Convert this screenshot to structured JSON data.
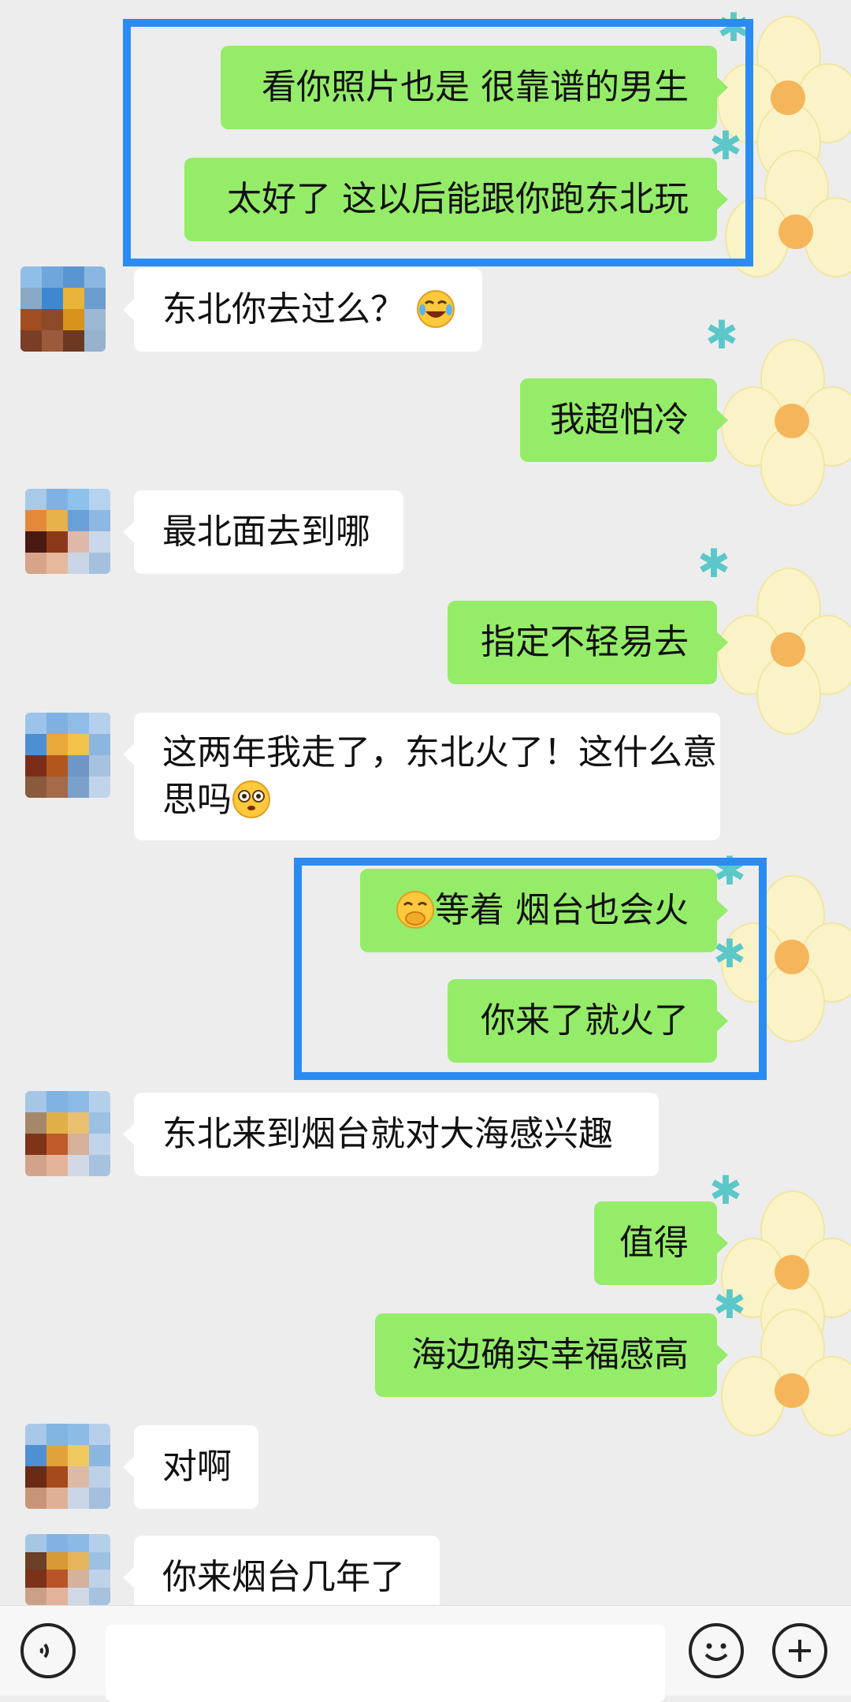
{
  "messages": [
    {
      "text": "看你照片也是 很靠谱的男生"
    },
    {
      "text": "太好了 这以后能跟你跑东北玩"
    },
    {
      "text": "东北你去过么？"
    },
    {
      "text": "我超怕冷"
    },
    {
      "text": "最北面去到哪"
    },
    {
      "text": "指定不轻易去"
    },
    {
      "text": "这两年我走了，东北火了！这什么意思吗"
    },
    {
      "text": "等着 烟台也会火"
    },
    {
      "text": "你来了就火了"
    },
    {
      "text": "东北来到烟台就对大海感兴趣"
    },
    {
      "text": "值得"
    },
    {
      "text": "海边确实幸福感高"
    },
    {
      "text": "对啊"
    },
    {
      "text": "你来烟台几年了"
    }
  ],
  "colors": {
    "background": "#ededed",
    "sent_bubble": "#95ec69",
    "received_bubble": "#ffffff",
    "highlight_box": "#2a8cf3"
  },
  "icons": {
    "voice": "voice-icon",
    "emoji": "emoji-icon",
    "more": "plus-icon"
  }
}
